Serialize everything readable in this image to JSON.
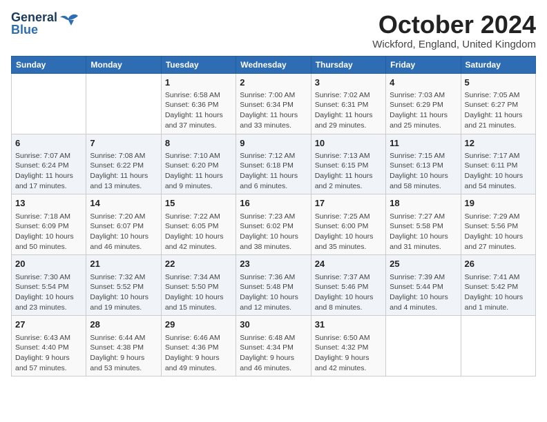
{
  "header": {
    "logo_line1": "General",
    "logo_line2": "Blue",
    "month_title": "October 2024",
    "location": "Wickford, England, United Kingdom"
  },
  "days_of_week": [
    "Sunday",
    "Monday",
    "Tuesday",
    "Wednesday",
    "Thursday",
    "Friday",
    "Saturday"
  ],
  "weeks": [
    [
      {
        "day": "",
        "info": ""
      },
      {
        "day": "",
        "info": ""
      },
      {
        "day": "1",
        "info": "Sunrise: 6:58 AM\nSunset: 6:36 PM\nDaylight: 11 hours and 37 minutes."
      },
      {
        "day": "2",
        "info": "Sunrise: 7:00 AM\nSunset: 6:34 PM\nDaylight: 11 hours and 33 minutes."
      },
      {
        "day": "3",
        "info": "Sunrise: 7:02 AM\nSunset: 6:31 PM\nDaylight: 11 hours and 29 minutes."
      },
      {
        "day": "4",
        "info": "Sunrise: 7:03 AM\nSunset: 6:29 PM\nDaylight: 11 hours and 25 minutes."
      },
      {
        "day": "5",
        "info": "Sunrise: 7:05 AM\nSunset: 6:27 PM\nDaylight: 11 hours and 21 minutes."
      }
    ],
    [
      {
        "day": "6",
        "info": "Sunrise: 7:07 AM\nSunset: 6:24 PM\nDaylight: 11 hours and 17 minutes."
      },
      {
        "day": "7",
        "info": "Sunrise: 7:08 AM\nSunset: 6:22 PM\nDaylight: 11 hours and 13 minutes."
      },
      {
        "day": "8",
        "info": "Sunrise: 7:10 AM\nSunset: 6:20 PM\nDaylight: 11 hours and 9 minutes."
      },
      {
        "day": "9",
        "info": "Sunrise: 7:12 AM\nSunset: 6:18 PM\nDaylight: 11 hours and 6 minutes."
      },
      {
        "day": "10",
        "info": "Sunrise: 7:13 AM\nSunset: 6:15 PM\nDaylight: 11 hours and 2 minutes."
      },
      {
        "day": "11",
        "info": "Sunrise: 7:15 AM\nSunset: 6:13 PM\nDaylight: 10 hours and 58 minutes."
      },
      {
        "day": "12",
        "info": "Sunrise: 7:17 AM\nSunset: 6:11 PM\nDaylight: 10 hours and 54 minutes."
      }
    ],
    [
      {
        "day": "13",
        "info": "Sunrise: 7:18 AM\nSunset: 6:09 PM\nDaylight: 10 hours and 50 minutes."
      },
      {
        "day": "14",
        "info": "Sunrise: 7:20 AM\nSunset: 6:07 PM\nDaylight: 10 hours and 46 minutes."
      },
      {
        "day": "15",
        "info": "Sunrise: 7:22 AM\nSunset: 6:05 PM\nDaylight: 10 hours and 42 minutes."
      },
      {
        "day": "16",
        "info": "Sunrise: 7:23 AM\nSunset: 6:02 PM\nDaylight: 10 hours and 38 minutes."
      },
      {
        "day": "17",
        "info": "Sunrise: 7:25 AM\nSunset: 6:00 PM\nDaylight: 10 hours and 35 minutes."
      },
      {
        "day": "18",
        "info": "Sunrise: 7:27 AM\nSunset: 5:58 PM\nDaylight: 10 hours and 31 minutes."
      },
      {
        "day": "19",
        "info": "Sunrise: 7:29 AM\nSunset: 5:56 PM\nDaylight: 10 hours and 27 minutes."
      }
    ],
    [
      {
        "day": "20",
        "info": "Sunrise: 7:30 AM\nSunset: 5:54 PM\nDaylight: 10 hours and 23 minutes."
      },
      {
        "day": "21",
        "info": "Sunrise: 7:32 AM\nSunset: 5:52 PM\nDaylight: 10 hours and 19 minutes."
      },
      {
        "day": "22",
        "info": "Sunrise: 7:34 AM\nSunset: 5:50 PM\nDaylight: 10 hours and 15 minutes."
      },
      {
        "day": "23",
        "info": "Sunrise: 7:36 AM\nSunset: 5:48 PM\nDaylight: 10 hours and 12 minutes."
      },
      {
        "day": "24",
        "info": "Sunrise: 7:37 AM\nSunset: 5:46 PM\nDaylight: 10 hours and 8 minutes."
      },
      {
        "day": "25",
        "info": "Sunrise: 7:39 AM\nSunset: 5:44 PM\nDaylight: 10 hours and 4 minutes."
      },
      {
        "day": "26",
        "info": "Sunrise: 7:41 AM\nSunset: 5:42 PM\nDaylight: 10 hours and 1 minute."
      }
    ],
    [
      {
        "day": "27",
        "info": "Sunrise: 6:43 AM\nSunset: 4:40 PM\nDaylight: 9 hours and 57 minutes."
      },
      {
        "day": "28",
        "info": "Sunrise: 6:44 AM\nSunset: 4:38 PM\nDaylight: 9 hours and 53 minutes."
      },
      {
        "day": "29",
        "info": "Sunrise: 6:46 AM\nSunset: 4:36 PM\nDaylight: 9 hours and 49 minutes."
      },
      {
        "day": "30",
        "info": "Sunrise: 6:48 AM\nSunset: 4:34 PM\nDaylight: 9 hours and 46 minutes."
      },
      {
        "day": "31",
        "info": "Sunrise: 6:50 AM\nSunset: 4:32 PM\nDaylight: 9 hours and 42 minutes."
      },
      {
        "day": "",
        "info": ""
      },
      {
        "day": "",
        "info": ""
      }
    ]
  ]
}
